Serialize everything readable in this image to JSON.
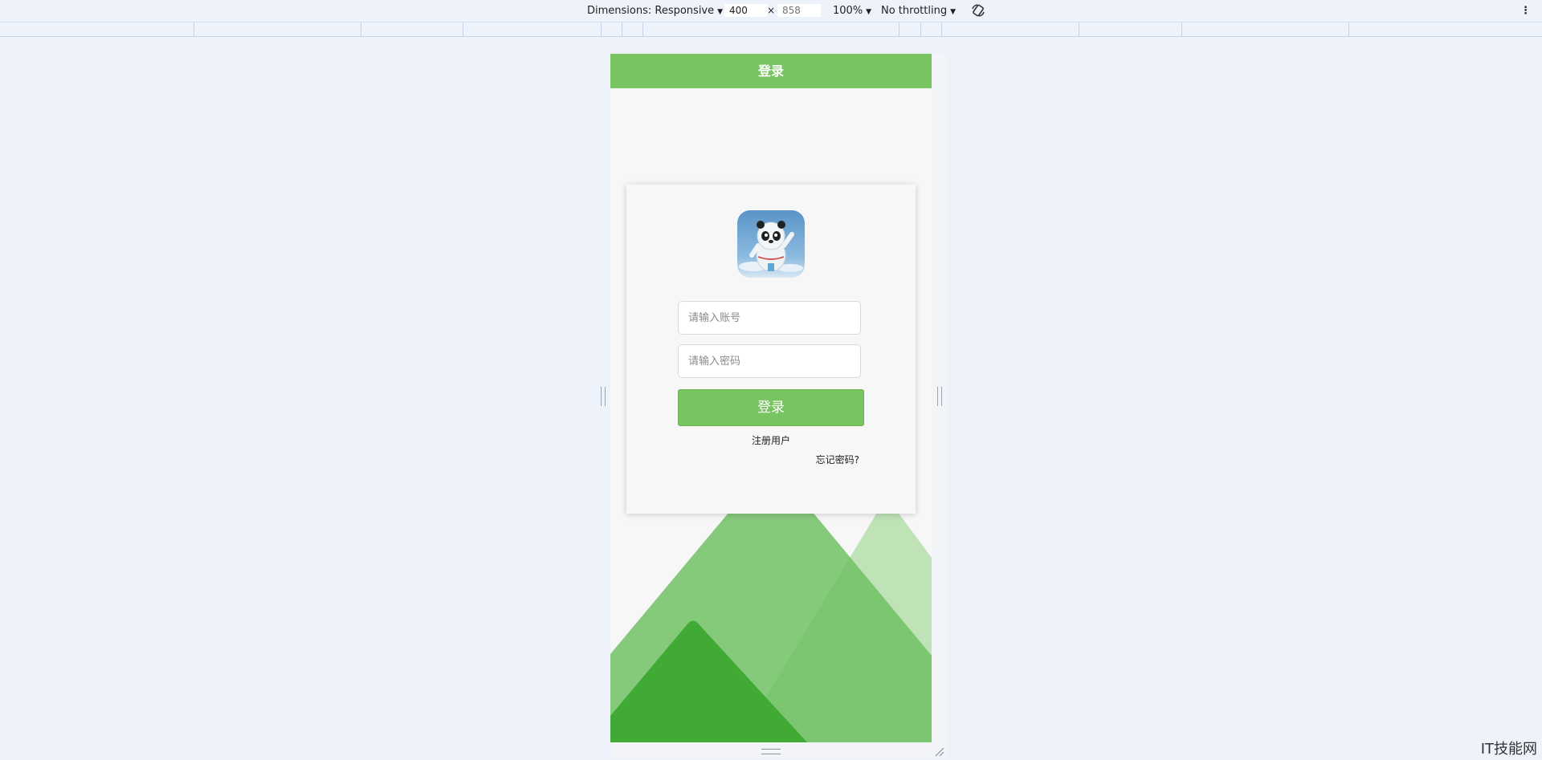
{
  "devtools": {
    "dimensions_label": "Dimensions: Responsive",
    "width_value": "400",
    "times_sign": "×",
    "height_placeholder": "858",
    "zoom": "100%",
    "throttling": "No throttling"
  },
  "app": {
    "header_title": "登录",
    "accent_color": "#78c460",
    "logo_icon": "panda-mascot-avatar",
    "username_placeholder": "请输入账号",
    "password_placeholder": "请输入密码",
    "login_button": "登录",
    "register_link": "注册用户",
    "forgot_link": "忘记密码?"
  },
  "watermark": "IT技能网"
}
